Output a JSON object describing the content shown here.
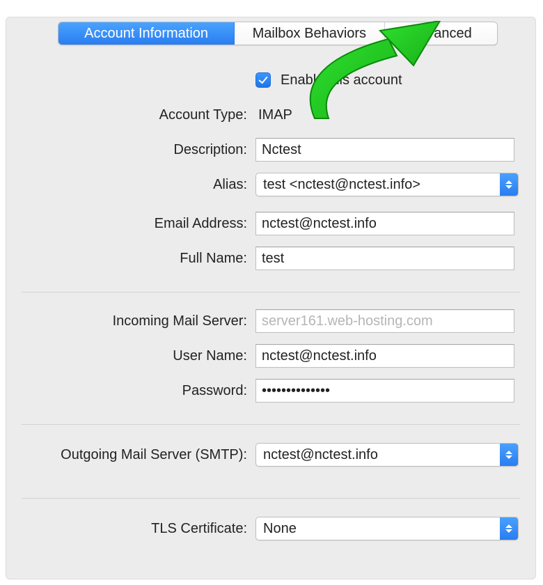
{
  "tabs": [
    {
      "label": "Account Information",
      "selected": true
    },
    {
      "label": "Mailbox Behaviors",
      "selected": false
    },
    {
      "label": "Advanced",
      "selected": false
    }
  ],
  "enable": {
    "label": "Enable this account",
    "checked": true
  },
  "fields": {
    "account_type": {
      "label": "Account Type:",
      "value": "IMAP"
    },
    "description": {
      "label": "Description:",
      "value": "Nctest"
    },
    "alias": {
      "label": "Alias:",
      "value": "test <nctest@nctest.info>"
    },
    "email": {
      "label": "Email Address:",
      "value": "nctest@nctest.info"
    },
    "full_name": {
      "label": "Full Name:",
      "value": "test"
    },
    "incoming": {
      "label": "Incoming Mail Server:",
      "value": "server161.web-hosting.com"
    },
    "username": {
      "label": "User Name:",
      "value": "nctest@nctest.info"
    },
    "password": {
      "label": "Password:",
      "value": "••••••••••••••"
    },
    "smtp": {
      "label": "Outgoing Mail Server (SMTP):",
      "value": "nctest@nctest.info"
    },
    "tls": {
      "label": "TLS Certificate:",
      "value": "None"
    }
  }
}
